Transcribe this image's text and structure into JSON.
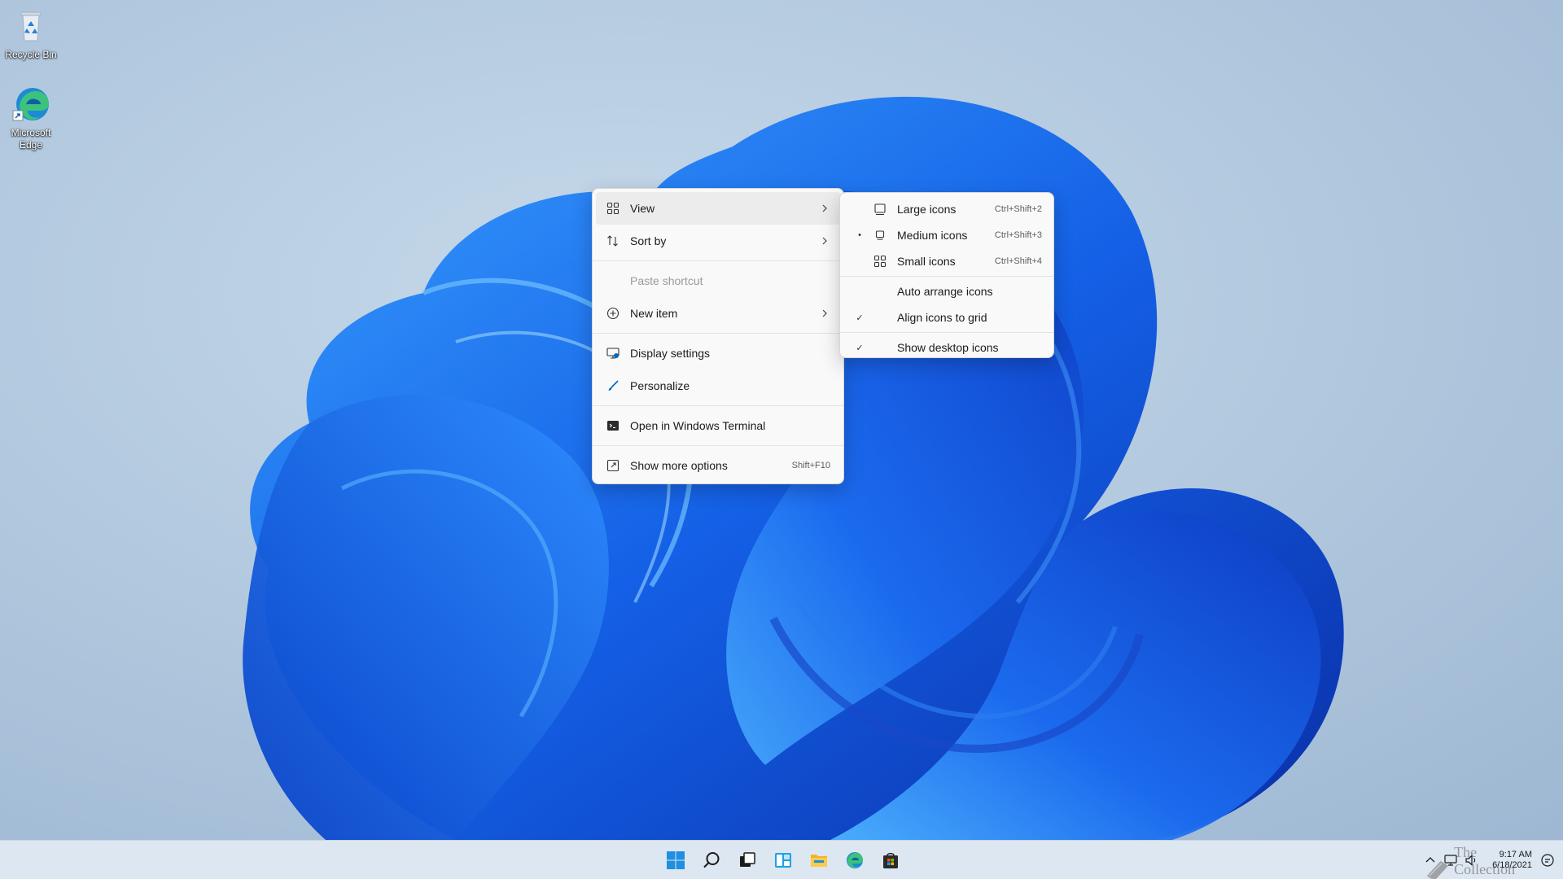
{
  "desktop": {
    "icons": [
      {
        "label": "Recycle Bin",
        "icon": "recycle-bin-icon"
      },
      {
        "label": "Microsoft Edge",
        "icon": "edge-icon"
      }
    ]
  },
  "context_menu": {
    "items": [
      {
        "label": "View",
        "icon": "grid-icon",
        "has_submenu": true,
        "highlighted": true
      },
      {
        "label": "Sort by",
        "icon": "sort-icon",
        "has_submenu": true
      },
      {
        "label": "Paste shortcut",
        "disabled": true
      },
      {
        "label": "New item",
        "icon": "plus-circle-icon",
        "has_submenu": true
      },
      {
        "label": "Display settings",
        "icon": "display-settings-icon"
      },
      {
        "label": "Personalize",
        "icon": "brush-icon"
      },
      {
        "label": "Open in Windows Terminal",
        "icon": "terminal-icon"
      },
      {
        "label": "Show more options",
        "icon": "more-options-icon",
        "shortcut": "Shift+F10"
      }
    ]
  },
  "view_submenu": {
    "items": [
      {
        "label": "Large icons",
        "icon": "large-icons-icon",
        "shortcut": "Ctrl+Shift+2",
        "mark": ""
      },
      {
        "label": "Medium icons",
        "icon": "medium-icons-icon",
        "shortcut": "Ctrl+Shift+3",
        "mark": "•"
      },
      {
        "label": "Small icons",
        "icon": "small-icons-icon",
        "shortcut": "Ctrl+Shift+4",
        "mark": ""
      },
      {
        "label": "Auto arrange icons",
        "mark": ""
      },
      {
        "label": "Align icons to grid",
        "mark": "✓"
      },
      {
        "label": "Show desktop icons",
        "mark": "✓"
      }
    ]
  },
  "taskbar": {
    "apps": [
      "start-icon",
      "search-icon",
      "task-view-icon",
      "widgets-icon",
      "file-explorer-icon",
      "edge-icon",
      "store-icon"
    ],
    "tray": {
      "watermark": "The Collection Book",
      "time": "9:17 AM",
      "date": "6/18/2021"
    }
  },
  "colors": {
    "accent": "#0067c0",
    "menu_bg": "#f9f9f9",
    "taskbar_bg": "#dde7f1"
  }
}
